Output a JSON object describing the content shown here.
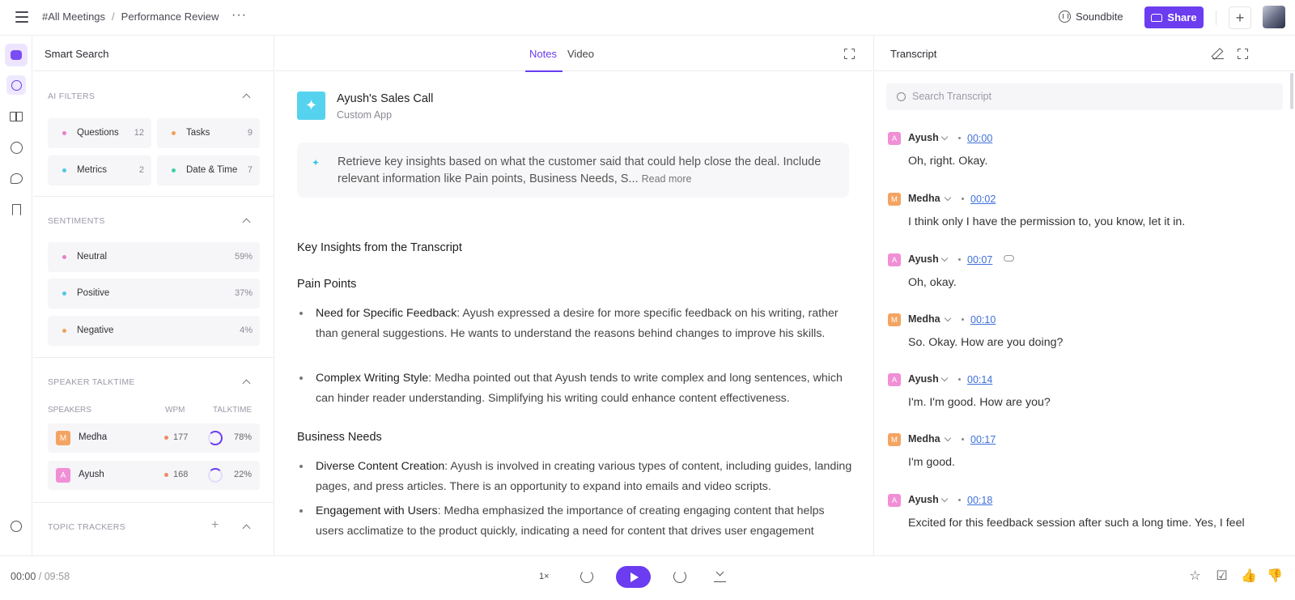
{
  "header": {
    "breadcrumb": [
      "#All Meetings",
      "Performance Review"
    ],
    "breadcrumb_sep": "/",
    "more": "···",
    "soundbite": "Soundbite",
    "share": "Share",
    "plus": "+"
  },
  "rail": {
    "icons": [
      "bot-logo-icon",
      "search-icon",
      "book-icon",
      "soundbite-icon",
      "chat-icon",
      "bookmark-icon",
      "smile-icon"
    ]
  },
  "left": {
    "title": "Smart Search",
    "ai_filters": {
      "title": "AI FILTERS",
      "chips": [
        {
          "label": "Questions",
          "count": "12",
          "color": "#e87ec8"
        },
        {
          "label": "Tasks",
          "count": "9",
          "color": "#f0a15a"
        },
        {
          "label": "Metrics",
          "count": "2",
          "color": "#4fc8e8"
        },
        {
          "label": "Date & Time",
          "count": "7",
          "color": "#3fcfa6"
        }
      ]
    },
    "sentiments": {
      "title": "SENTIMENTS",
      "items": [
        {
          "label": "Neutral",
          "value": "59%",
          "color": "#e87ec8"
        },
        {
          "label": "Positive",
          "value": "37%",
          "color": "#4fc8e8"
        },
        {
          "label": "Negative",
          "value": "4%",
          "color": "#f0a15a"
        }
      ]
    },
    "talktime": {
      "title": "SPEAKER TALKTIME",
      "headers": {
        "speakers": "SPEAKERS",
        "wpm": "WPM",
        "talktime": "TALKTIME"
      },
      "speakers": [
        {
          "initial": "M",
          "name": "Medha",
          "wpm": "177",
          "talktime": "78%",
          "color": "#f4a462",
          "share": 0.78
        },
        {
          "initial": "A",
          "name": "Ayush",
          "wpm": "168",
          "talktime": "22%",
          "color": "#f08fd6",
          "share": 0.22
        }
      ]
    },
    "topic_trackers": {
      "title": "TOPIC TRACKERS"
    }
  },
  "center": {
    "tabs": [
      "Notes",
      "Video"
    ],
    "app": {
      "name": "Ayush's Sales Call",
      "subtitle": "Custom App",
      "icon": "sparkle-icon"
    },
    "prompt": {
      "text": "Retrieve key insights based on what the customer said that could help close the deal. Include relevant information like Pain points, Business Needs, S...",
      "read_more": "Read more"
    },
    "heading": "Key Insights from the Transcript",
    "sections": [
      {
        "title": "Pain Points",
        "bullets": [
          {
            "term": "Need for Specific Feedback",
            "text": ": Ayush expressed a desire for more specific feedback on his writing, rather than general suggestions. He wants to understand the reasons behind changes to improve his skills."
          },
          {
            "term": "Complex Writing Style",
            "text": ": Medha pointed out that Ayush tends to write complex and long sentences, which can hinder reader understanding. Simplifying his writing could enhance content effectiveness."
          }
        ]
      },
      {
        "title": "Business Needs",
        "bullets": [
          {
            "term": "Diverse Content Creation",
            "text": ": Ayush is involved in creating various types of content, including guides, landing pages, and press articles. There is an opportunity to expand into emails and video scripts."
          },
          {
            "term": "Engagement with Users",
            "text": ": Medha emphasized the importance of creating engaging content that helps users acclimatize to the product quickly, indicating a need for content that drives user engagement"
          }
        ]
      }
    ]
  },
  "transcript": {
    "title": "Transcript",
    "search_placeholder": "Search Transcript",
    "entries": [
      {
        "initial": "A",
        "speaker": "Ayush",
        "time": "00:00",
        "text": "Oh, right. Okay.",
        "color": "#f08fd6"
      },
      {
        "initial": "M",
        "speaker": "Medha",
        "time": "00:02",
        "text": "I think only I have the permission to, you know, let it in.",
        "color": "#f4a462"
      },
      {
        "initial": "A",
        "speaker": "Ayush",
        "time": "00:07",
        "text": "Oh, okay.",
        "color": "#f08fd6",
        "link": true
      },
      {
        "initial": "M",
        "speaker": "Medha",
        "time": "00:10",
        "text": "So. Okay. How are you doing?",
        "color": "#f4a462"
      },
      {
        "initial": "A",
        "speaker": "Ayush",
        "time": "00:14",
        "text": "I'm. I'm good. How are you?",
        "color": "#f08fd6"
      },
      {
        "initial": "M",
        "speaker": "Medha",
        "time": "00:17",
        "text": "I'm good.",
        "color": "#f4a462"
      },
      {
        "initial": "A",
        "speaker": "Ayush",
        "time": "00:18",
        "text": "Excited for this feedback session after such a long time. Yes, I feel",
        "color": "#f08fd6"
      }
    ]
  },
  "player": {
    "current": "00:00",
    "separator": "/",
    "total": "09:58",
    "speed": "1×",
    "actions": [
      "star-icon",
      "task-icon",
      "thumbs-up-icon",
      "thumbs-down-icon"
    ]
  }
}
